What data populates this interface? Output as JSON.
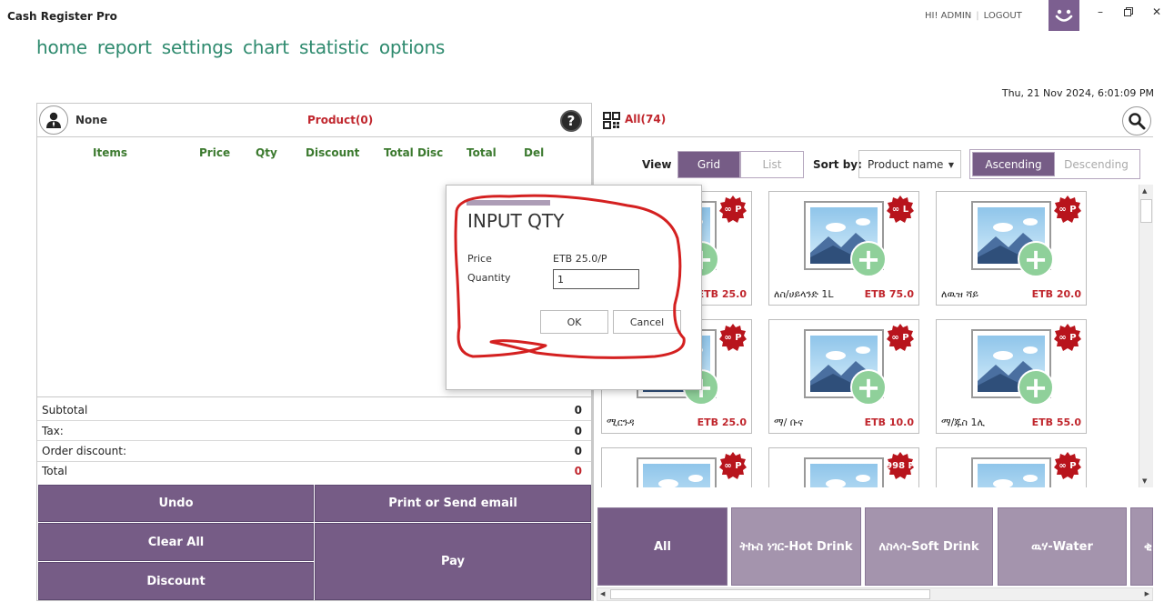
{
  "app": {
    "title": "Cash Register Pro",
    "greeting": "HI! ADMIN",
    "logout": "LOGOUT",
    "datetime": "Thu, 21 Nov 2024, 6:01:09 PM"
  },
  "nav": [
    "home",
    "report",
    "settings",
    "chart",
    "statistic",
    "options"
  ],
  "order": {
    "customer": "None",
    "product_count": "Product(0)",
    "columns": [
      "Items",
      "Price",
      "Qty",
      "Discount",
      "Total Disc",
      "Total",
      "Del"
    ],
    "totals": [
      {
        "label": "Subtotal",
        "value": "0"
      },
      {
        "label": "Tax:",
        "value": "0"
      },
      {
        "label": "Order discount:",
        "value": "0"
      },
      {
        "label": "Total",
        "value": "0"
      }
    ],
    "buttons": {
      "undo": "Undo",
      "print": "Print or Send email",
      "clear": "Clear All",
      "pay": "Pay",
      "discount": "Discount"
    }
  },
  "catalog": {
    "all_label": "All(74)",
    "view_label": "View",
    "view_grid": "Grid",
    "view_list": "List",
    "sort_label": "Sort by:",
    "sort_value": "Product name",
    "ascending": "Ascending",
    "descending": "Descending",
    "products": [
      {
        "name": "",
        "price": "ETB 25.0",
        "badge": "∞ P"
      },
      {
        "name": "ለስ/ሀይላንድ 1L",
        "price": "ETB 75.0",
        "badge": "∞ L"
      },
      {
        "name": "ለዉዝ ሻይ",
        "price": "ETB 20.0",
        "badge": "∞ P"
      },
      {
        "name": "ሚርንዳ",
        "price": "ETB 25.0",
        "badge": "∞ P"
      },
      {
        "name": "ማ/ ቡና",
        "price": "ETB 10.0",
        "badge": "∞ P"
      },
      {
        "name": "ማ/ጁስ 1ሊ",
        "price": "ETB 55.0",
        "badge": "∞ P"
      },
      {
        "name": "",
        "price": "",
        "badge": "∞ P"
      },
      {
        "name": "",
        "price": "",
        "badge": "998 P"
      },
      {
        "name": "",
        "price": "",
        "badge": "∞ P"
      }
    ],
    "categories": [
      "All",
      "ትኩስ ነገር-Hot Drink",
      "ለስላሳ-Soft Drink",
      "ዉሃ-Water",
      "ቂ"
    ]
  },
  "dialog": {
    "title": "INPUT QTY",
    "price_label": "Price",
    "price_value": "ETB 25.0/P",
    "qty_label": "Quantity",
    "qty_value": "1",
    "ok": "OK",
    "cancel": "Cancel"
  },
  "colors": {
    "accent_purple": "#765c86",
    "nav_green": "#2e8a6e",
    "price_red": "#c0262d",
    "annotation_red": "#d42020"
  }
}
